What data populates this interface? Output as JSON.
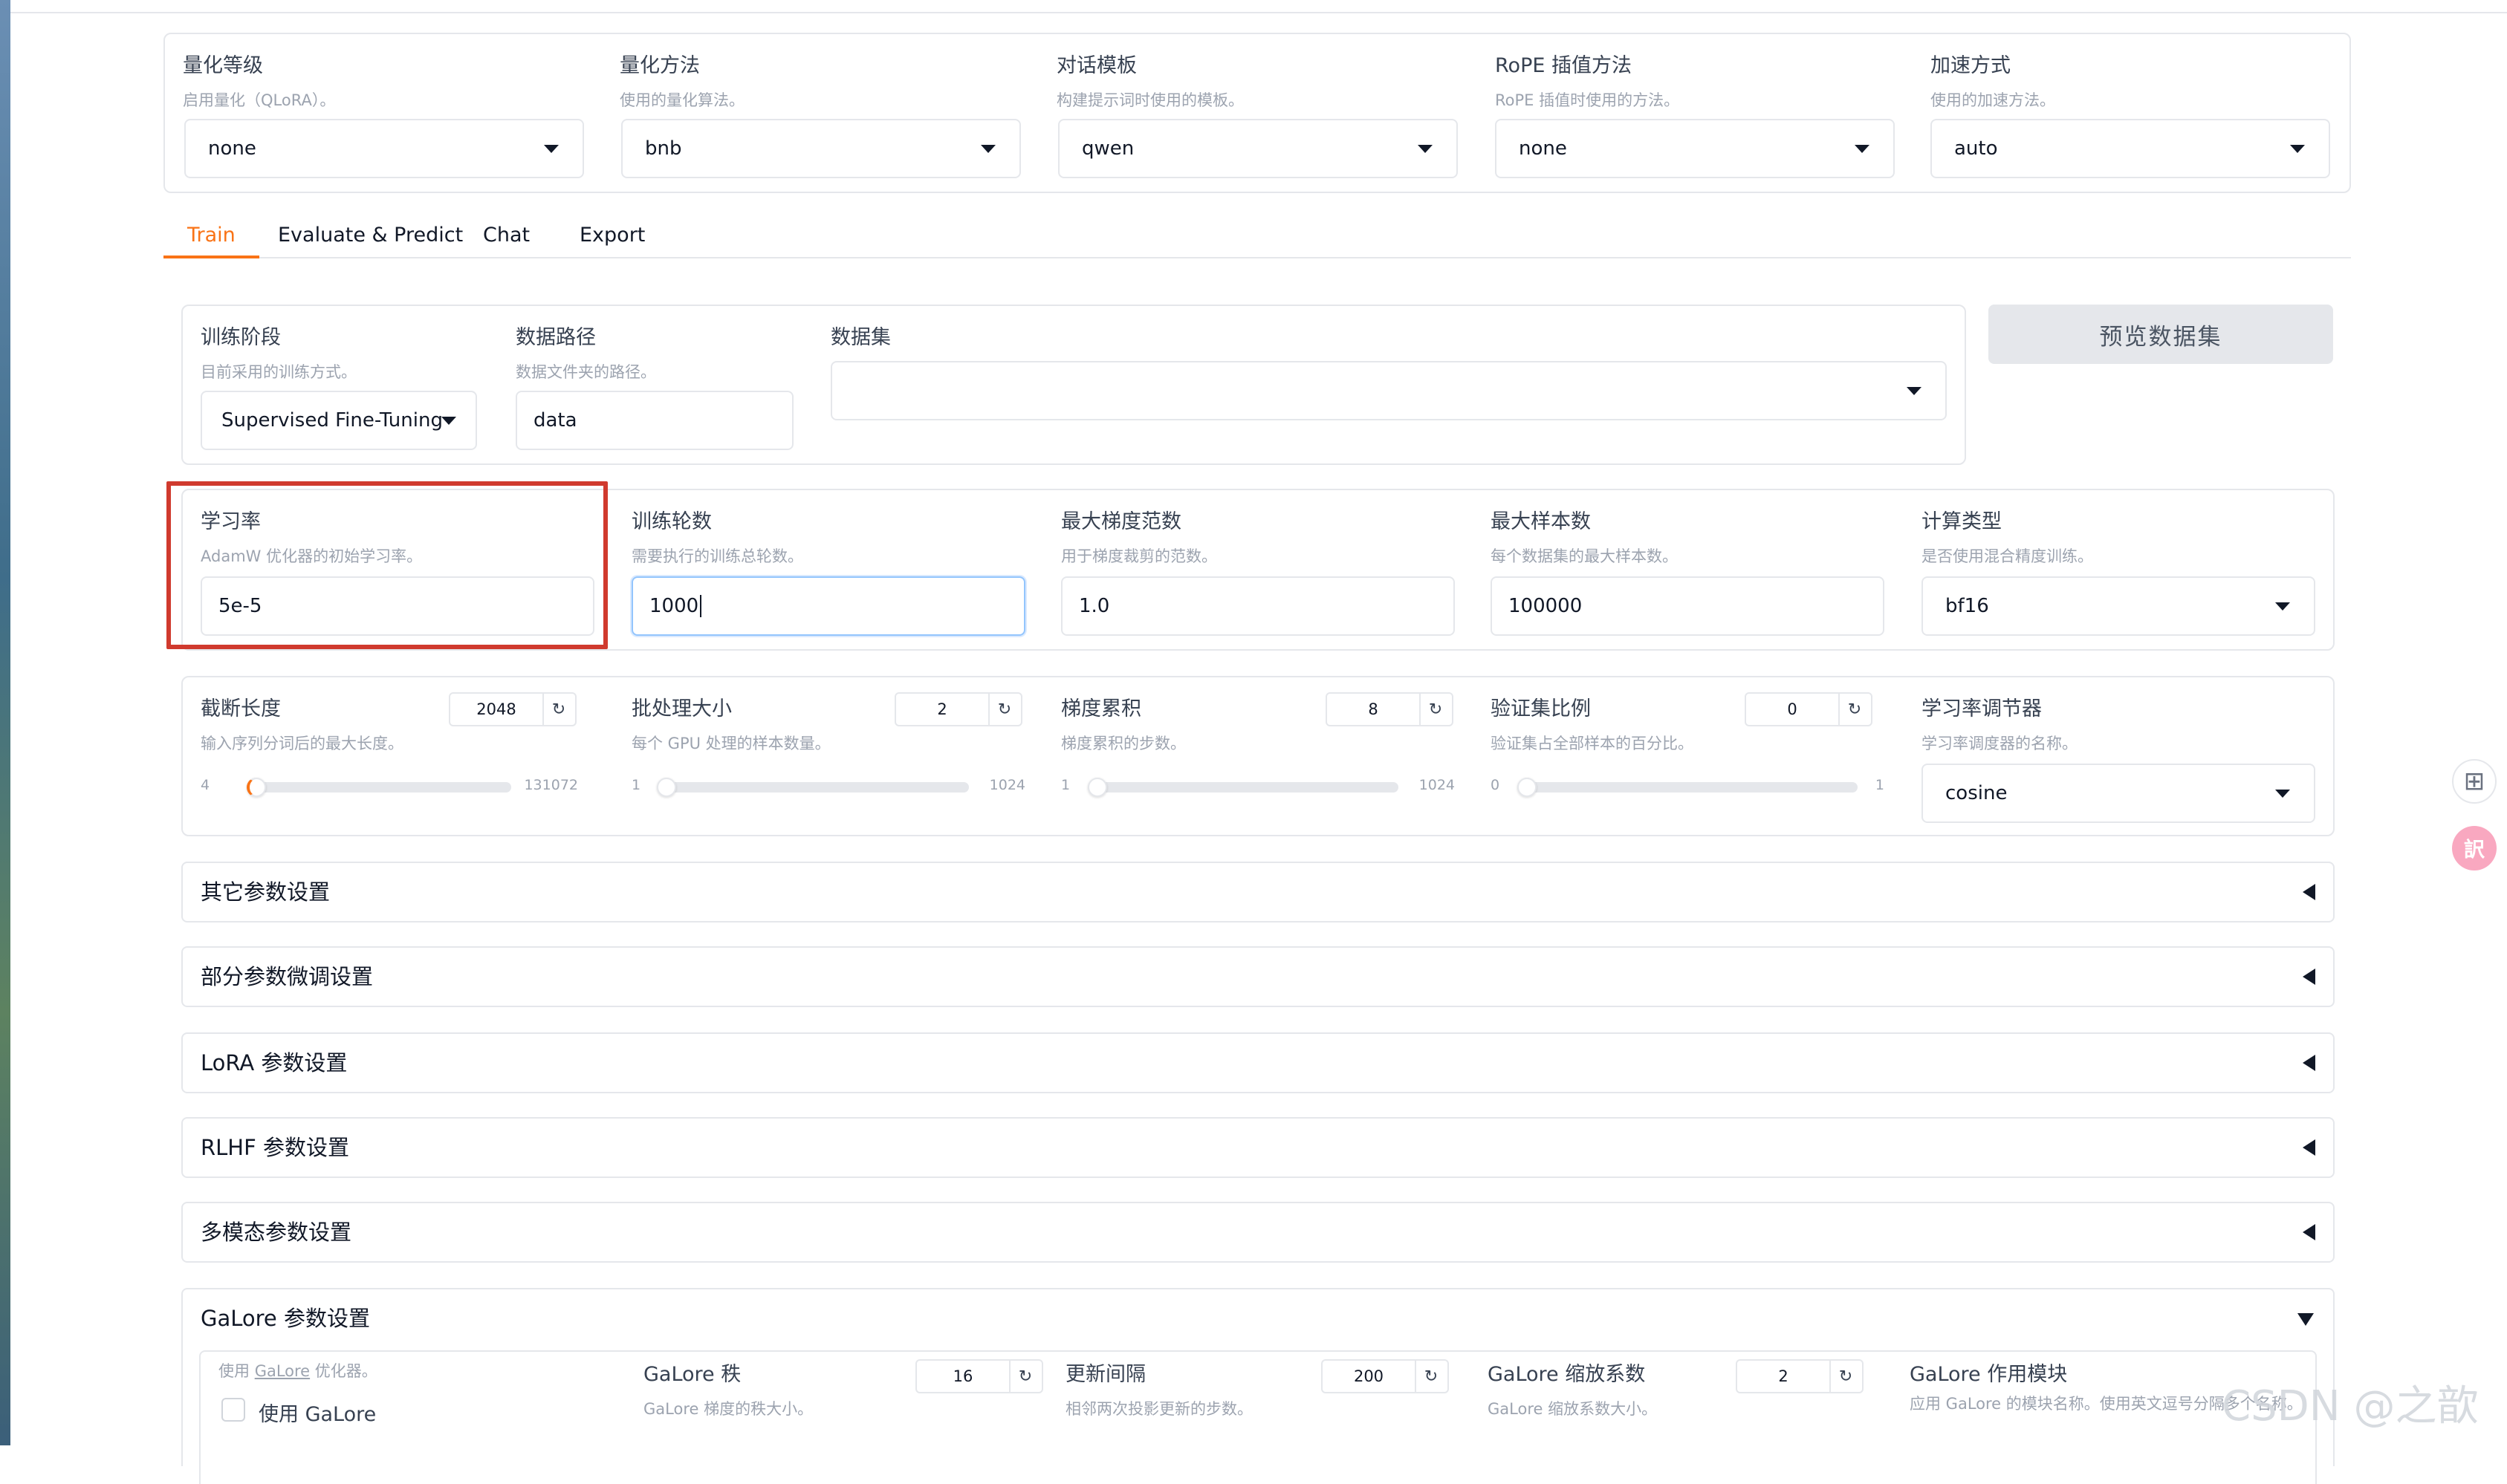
{
  "top_settings": [
    {
      "label": "量化等级",
      "info": "启用量化（QLoRA）。",
      "value": "none"
    },
    {
      "label": "量化方法",
      "info": "使用的量化算法。",
      "value": "bnb"
    },
    {
      "label": "对话模板",
      "info": "构建提示词时使用的模板。",
      "value": "qwen"
    },
    {
      "label": "RoPE 插值方法",
      "info": "RoPE 插值时使用的方法。",
      "value": "none"
    },
    {
      "label": "加速方式",
      "info": "使用的加速方法。",
      "value": "auto"
    }
  ],
  "tabs": [
    "Train",
    "Evaluate & Predict",
    "Chat",
    "Export"
  ],
  "train": {
    "stage": {
      "label": "训练阶段",
      "info": "目前采用的训练方式。",
      "value": "Supervised Fine-Tuning"
    },
    "dataset_dir": {
      "label": "数据路径",
      "info": "数据文件夹的路径。",
      "value": "data"
    },
    "dataset": {
      "label": "数据集",
      "value": ""
    },
    "preview_button": "预览数据集",
    "learning_rate": {
      "label": "学习率",
      "info": "AdamW 优化器的初始学习率。",
      "value": "5e-5"
    },
    "epochs": {
      "label": "训练轮数",
      "info": "需要执行的训练总轮数。",
      "value": "1000"
    },
    "max_grad_norm": {
      "label": "最大梯度范数",
      "info": "用于梯度裁剪的范数。",
      "value": "1.0"
    },
    "max_samples": {
      "label": "最大样本数",
      "info": "每个数据集的最大样本数。",
      "value": "100000"
    },
    "compute_type": {
      "label": "计算类型",
      "info": "是否使用混合精度训练。",
      "value": "bf16"
    },
    "cutoff_len": {
      "label": "截断长度",
      "info": "输入序列分词后的最大长度。",
      "value": "2048",
      "min": "4",
      "max": "131072"
    },
    "batch_size": {
      "label": "批处理大小",
      "info": "每个 GPU 处理的样本数量。",
      "value": "2",
      "min": "1",
      "max": "1024"
    },
    "grad_accum": {
      "label": "梯度累积",
      "info": "梯度累积的步数。",
      "value": "8",
      "min": "1",
      "max": "1024"
    },
    "val_size": {
      "label": "验证集比例",
      "info": "验证集占全部样本的百分比。",
      "value": "0",
      "min": "0",
      "max": "1"
    },
    "lr_scheduler": {
      "label": "学习率调节器",
      "info": "学习率调度器的名称。",
      "value": "cosine"
    }
  },
  "accordions": [
    "其它参数设置",
    "部分参数微调设置",
    "LoRA 参数设置",
    "RLHF 参数设置",
    "多模态参数设置"
  ],
  "galore": {
    "title": "GaLore 参数设置",
    "use_info_prefix": "使用 ",
    "use_info_link": "GaLore",
    "use_info_suffix": " 优化器。",
    "use_label": "使用 GaLore",
    "rank": {
      "label": "GaLore 秩",
      "info": "GaLore 梯度的秩大小。",
      "value": "16"
    },
    "update_interval": {
      "label": "更新间隔",
      "info": "相邻两次投影更新的步数。",
      "value": "200"
    },
    "scale": {
      "label": "GaLore 缩放系数",
      "info": "GaLore 缩放系数大小。",
      "value": "2"
    },
    "target": {
      "label": "GaLore 作用模块",
      "info": "应用 GaLore 的模块名称。使用英文逗号分隔多个名称。"
    }
  },
  "floating": {
    "grid_icon": "⊞",
    "translate_icon": "訳"
  },
  "watermark": "CSDN @之歆"
}
